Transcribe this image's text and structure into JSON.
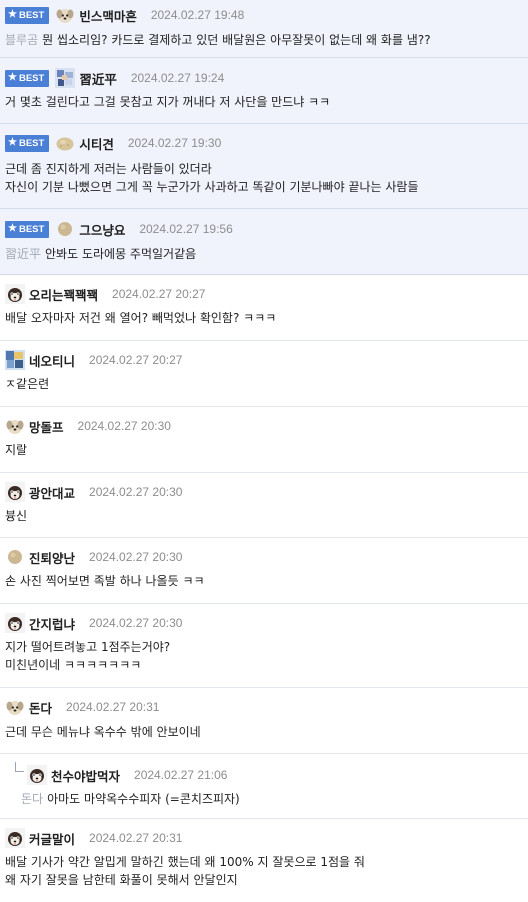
{
  "best_badge": "BEST",
  "comments": [
    {
      "best": true,
      "avatar": "dog-avatar",
      "nick": "빈스맥마흔",
      "date": "2024.02.27 19:48",
      "mention": "블루곰",
      "text": "뭔 씹소리임? 카드로 결제하고 있던 배달원은 아무잘못이 없는데 왜 화를 냄??"
    },
    {
      "best": true,
      "avatar": "pixel-avatar",
      "nick": "習近平",
      "date": "2024.02.27 19:24",
      "mention": "",
      "text": "거 몇초 걸린다고 그걸 못참고 지가 꺼내다 저 사단을 만드냐 ㅋㅋ"
    },
    {
      "best": true,
      "avatar": "potato-avatar",
      "nick": "시티견",
      "date": "2024.02.27 19:30",
      "mention": "",
      "text": "근데 좀 진지하게 저러는 사람들이 있더라\n자신이 기분 나뻤으면 그게 꼭 누군가가 사과하고 똑같이 기분나빠야 끝나는 사람들"
    },
    {
      "best": true,
      "avatar": "dot-avatar",
      "nick": "그으냥요",
      "date": "2024.02.27 19:56",
      "mention": "習近平",
      "text": "안봐도 도라에몽 주먹일거같음"
    },
    {
      "best": false,
      "avatar": "dog-face-avatar",
      "nick": "오리는꽥꽥꽥",
      "date": "2024.02.27 20:27",
      "mention": "",
      "text": "배달 오자마자 저건 왜 열어? 빼먹었나 확인함? ㅋㅋㅋ"
    },
    {
      "best": false,
      "avatar": "pixel-avatar",
      "nick": "네오티니",
      "date": "2024.02.27 20:27",
      "mention": "",
      "text": "ㅈ같은련"
    },
    {
      "best": false,
      "avatar": "dog-avatar",
      "nick": "망돌프",
      "date": "2024.02.27 20:30",
      "mention": "",
      "text": "지랄"
    },
    {
      "best": false,
      "avatar": "dog-face-avatar",
      "nick": "광안대교",
      "date": "2024.02.27 20:30",
      "mention": "",
      "text": "븅신"
    },
    {
      "best": false,
      "avatar": "dot-avatar",
      "nick": "진퇴양난",
      "date": "2024.02.27 20:30",
      "mention": "",
      "text": "손 사진 찍어보면 족발 하나 나올듯 ㅋㅋ"
    },
    {
      "best": false,
      "avatar": "dog-face-avatar",
      "nick": "간지럽냐",
      "date": "2024.02.27 20:30",
      "mention": "",
      "text": "지가 떨어트려놓고 1점주는거야?\n미친년이네 ㅋㅋㅋㅋㅋㅋㅋ"
    },
    {
      "best": false,
      "avatar": "dog-avatar",
      "nick": "돈다",
      "date": "2024.02.27 20:31",
      "mention": "",
      "text": "근데 무슨 메뉴냐 옥수수 밖에 안보이네"
    },
    {
      "best": false,
      "reply": true,
      "avatar": "dog-face-avatar",
      "nick": "천수야밥먹자",
      "date": "2024.02.27 21:06",
      "mention": "돈다",
      "text": "아마도 마약옥수수피자 (=콘치즈피자)"
    },
    {
      "best": false,
      "avatar": "dog-face-avatar",
      "nick": "커글말이",
      "date": "2024.02.27 20:31",
      "mention": "",
      "text": "배달 기사가 약간 알밉게 말하긴 했는데 왜 100% 지 잘못으로 1점을 줘\n왜 자기 잘못을 남한테 화풀이 못해서 안달인지"
    }
  ]
}
